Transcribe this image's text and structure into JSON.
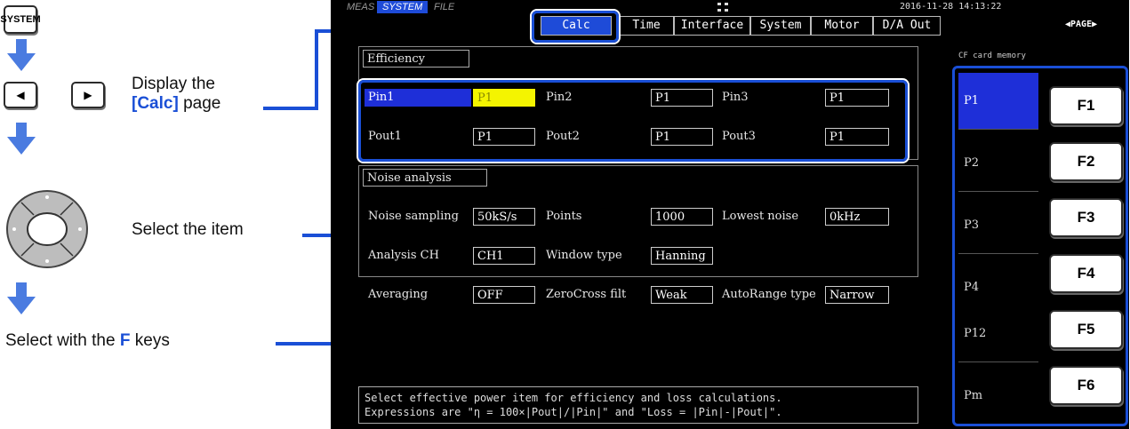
{
  "instructions": {
    "system_key": "SYSTEM",
    "left_key": "◀",
    "right_key": "▶",
    "display_text": "Display the",
    "display_page": "[Calc]",
    "display_suffix": "page",
    "select_item": "Select the item",
    "select_f_prefix": "Select with the",
    "select_f_key": "F",
    "select_f_suffix": "keys"
  },
  "screen": {
    "mode_tabs": [
      "MEAS",
      "SYSTEM",
      "FILE"
    ],
    "active_mode": "SYSTEM",
    "datetime": "2016-11-28 14:13:22",
    "page_indicator": "◀PAGE▶",
    "tabs": [
      "Calc",
      "Time",
      "Interface",
      "System",
      "Motor",
      "D/A Out"
    ],
    "active_tab": "Calc",
    "efficiency": {
      "label": "Efficiency",
      "row1": [
        {
          "label": "Pin1",
          "value": "P1"
        },
        {
          "label": "Pin2",
          "value": "P1"
        },
        {
          "label": "Pin3",
          "value": "P1"
        }
      ],
      "row2": [
        {
          "label": "Pout1",
          "value": "P1"
        },
        {
          "label": "Pout2",
          "value": "P1"
        },
        {
          "label": "Pout3",
          "value": "P1"
        }
      ]
    },
    "noise": {
      "label": "Noise analysis",
      "row1": [
        {
          "label": "Noise sampling",
          "value": "50kS/s"
        },
        {
          "label": "Points",
          "value": "1000"
        },
        {
          "label": "Lowest noise",
          "value": "0kHz"
        }
      ],
      "row2": [
        {
          "label": "Analysis CH",
          "value": "CH1"
        },
        {
          "label": "Window type",
          "value": "Hanning"
        }
      ]
    },
    "misc": [
      {
        "label": "Averaging",
        "value": "OFF"
      },
      {
        "label": "ZeroCross filt",
        "value": "Weak"
      },
      {
        "label": "AutoRange type",
        "value": "Narrow"
      }
    ],
    "help_line1": "Select effective power item for efficiency and loss calculations.",
    "help_line2": "Expressions are \"η = 100×|Pout|/|Pin|\" and \"Loss = |Pin|-|Pout|\".",
    "cf_label": "CF card memory",
    "fmenu": [
      "P1",
      "P2",
      "P3",
      "P4",
      "P12",
      "Pm"
    ],
    "fkeys": [
      "F1",
      "F2",
      "F3",
      "F4",
      "F5",
      "F6"
    ]
  },
  "colors": {
    "accent_blue": "#1a4fd6",
    "selected_value": "#f4f400",
    "screen_bg": "#000000"
  }
}
